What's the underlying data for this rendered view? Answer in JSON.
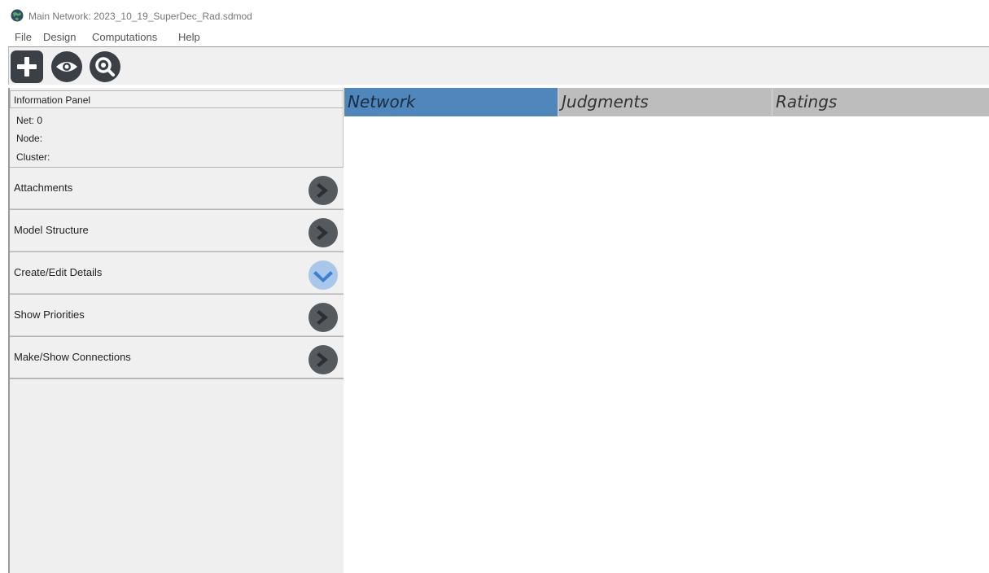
{
  "window": {
    "title": "Main Network: 2023_10_19_SuperDec_Rad.sdmod"
  },
  "menu": [
    "File",
    "Design",
    "Computations",
    "Help"
  ],
  "toolbar": {
    "icons": [
      "plus-icon",
      "eye-icon",
      "search-icon"
    ]
  },
  "info_panel": {
    "header": "Information Panel",
    "net": "Net: 0",
    "node": "Node:",
    "cluster": "Cluster:"
  },
  "sections": [
    {
      "label": "Attachments",
      "state": "collapsed"
    },
    {
      "label": "Model Structure",
      "state": "collapsed"
    },
    {
      "label": "Create/Edit Details",
      "state": "expanded"
    },
    {
      "label": "Show Priorities",
      "state": "collapsed"
    },
    {
      "label": "Make/Show Connections",
      "state": "collapsed"
    }
  ],
  "tabs": [
    {
      "label": "Network",
      "active": true
    },
    {
      "label": "Judgments",
      "active": false
    },
    {
      "label": "Ratings",
      "active": false
    }
  ],
  "colors": {
    "active_tab": "#4f86bc",
    "inactive_tab": "#bdbdbd",
    "dark_button": "#555a5e",
    "expanded_button": "#a9c7ea",
    "panel_bg": "#f0f0f0"
  }
}
